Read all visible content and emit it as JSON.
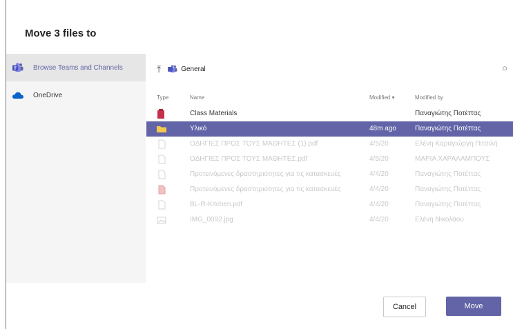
{
  "dialog": {
    "title": "Move 3 files to"
  },
  "sidebar": {
    "items": [
      {
        "label": "Browse Teams and Channels",
        "icon": "teams-icon",
        "selected": true
      },
      {
        "label": "OneDrive",
        "icon": "onedrive-icon",
        "selected": false
      }
    ]
  },
  "breadcrumb": {
    "up_icon": "up-arrow-icon",
    "location": "General",
    "refresh_icon": "refresh-icon"
  },
  "table": {
    "headers": {
      "type": "Type",
      "name": "Name",
      "modified": "Modified ▾",
      "modified_by": "Modified by"
    },
    "rows": [
      {
        "type_icon": "folder-red-icon",
        "name": "Class Materials",
        "modified": "",
        "modified_by": "Παναγιώτης Ποτέττας",
        "state": "normal"
      },
      {
        "type_icon": "folder-icon",
        "name": "Υλικό",
        "modified": "48m ago",
        "modified_by": "Παναγιώτης Ποτέττας",
        "state": "selected"
      },
      {
        "type_icon": "file-icon",
        "name": "ΟΔΗΓΙΕΣ ΠΡΟΣ ΤΟΥΣ ΜΑΘΗΤΕΣ (1).pdf",
        "modified": "4/5/20",
        "modified_by": "Ελένη Καραγιώργη Πιτσιλή",
        "state": "disabled"
      },
      {
        "type_icon": "file-icon",
        "name": "ΟΔΗΓΙΕΣ ΠΡΟΣ ΤΟΥΣ ΜΑΘΗΤΕΣ.pdf",
        "modified": "4/5/20",
        "modified_by": "ΜΑΡΙΑ ΧΑΡΑΛΑΜΠΟΥΣ",
        "state": "disabled"
      },
      {
        "type_icon": "file-icon",
        "name": "Προτεινόμενες δραστηριότητες για τις κατασκευές",
        "modified": "4/4/20",
        "modified_by": "Παναγιώτης Ποτέττας",
        "state": "disabled"
      },
      {
        "type_icon": "file-pdf-icon",
        "name": "Προτεινόμενες δραστηριότητες για τις κατασκευές",
        "modified": "4/4/20",
        "modified_by": "Παναγιώτης Ποτέττας",
        "state": "disabled"
      },
      {
        "type_icon": "file-icon",
        "name": "BL-R-Kitchen.pdf",
        "modified": "4/4/20",
        "modified_by": "Παναγιώτης Ποτέττας",
        "state": "disabled"
      },
      {
        "type_icon": "image-icon",
        "name": "IMG_0092.jpg",
        "modified": "4/4/20",
        "modified_by": "Ελένη Νικολάου",
        "state": "disabled"
      }
    ]
  },
  "buttons": {
    "cancel": "Cancel",
    "move": "Move"
  },
  "colors": {
    "accent": "#6264a7",
    "folder_yellow": "#f2c94c",
    "folder_red": "#c4314b"
  }
}
